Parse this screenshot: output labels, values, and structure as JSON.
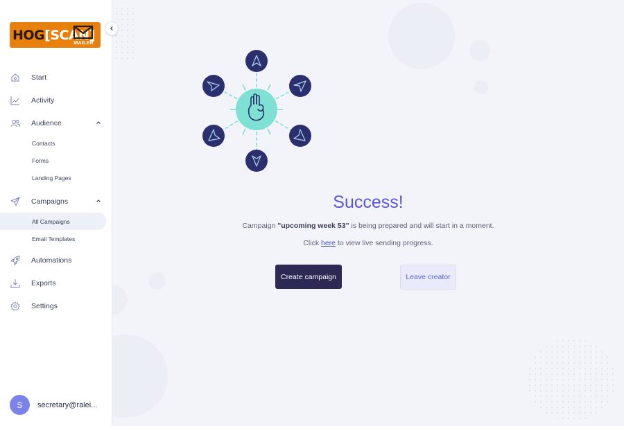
{
  "brand": {
    "logo_text_a": "HOG",
    "logo_text_b": "[SCAN]",
    "logo_sub": "MAILER",
    "logo_color": "#e8800e"
  },
  "sidebar": {
    "collapse_icon": "chevron-left-icon",
    "items": [
      {
        "label": "Start",
        "icon": "home-icon"
      },
      {
        "label": "Activity",
        "icon": "chart-line-icon"
      },
      {
        "label": "Audience",
        "icon": "users-icon",
        "expanded": true,
        "children": [
          "Contacts",
          "Forms",
          "Landing Pages"
        ]
      },
      {
        "label": "Campaigns",
        "icon": "paper-plane-icon",
        "expanded": true,
        "children": [
          "All Campaigns",
          "Email Templates"
        ],
        "active_child": "All Campaigns"
      },
      {
        "label": "Automations",
        "icon": "rocket-icon"
      },
      {
        "label": "Exports",
        "icon": "download-icon"
      },
      {
        "label": "Settings",
        "icon": "gear-icon"
      }
    ]
  },
  "user": {
    "avatar_initial": "S",
    "email": "secretary@ralei..."
  },
  "main": {
    "title": "Success!",
    "line1_prefix": "Campaign ",
    "campaign_name": "\"upcoming week 53\"",
    "line1_suffix": " is being prepared and will start in a moment.",
    "line2_prefix": "Click ",
    "line2_link": "here",
    "line2_suffix": " to view live sending progress.",
    "primary_button": "Create campaign",
    "secondary_button": "Leave creator"
  },
  "colors": {
    "accent": "#5a54d6",
    "primary_button": "#2c2a55",
    "illustration_center": "#7fe0d4",
    "illustration_node": "#2c2f6e"
  }
}
